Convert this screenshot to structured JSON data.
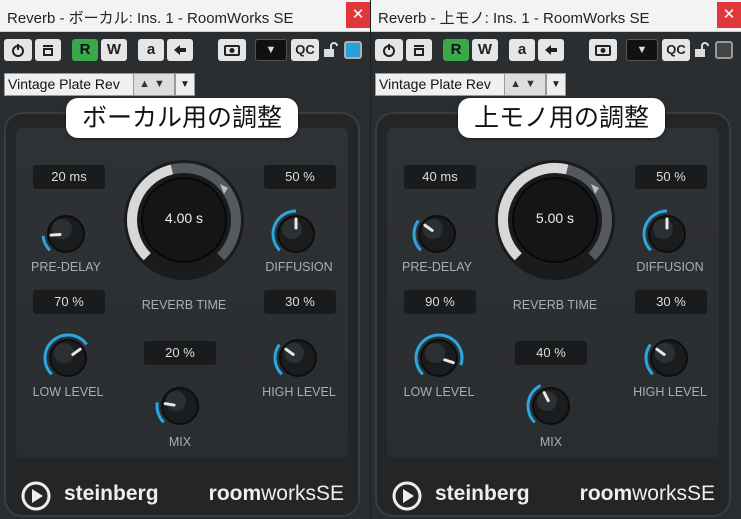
{
  "windows": [
    {
      "title": "Reverb - ボーカル: Ins. 1 - RoomWorks SE",
      "close_glyph": "✕",
      "toolbar": {
        "r_label": "R",
        "w_label": "W",
        "a_label": "a",
        "qc_label": "QC",
        "dropdown_glyph": "▼",
        "active_indicator": "blue"
      },
      "preset": {
        "name": "Vintage Plate Rev",
        "arrows": "▲▼",
        "dropdown": "▼"
      },
      "caption": "ボーカル用の調整",
      "params": {
        "pre_delay": {
          "label": "PRE-DELAY",
          "value": "20 ms",
          "level": 0.15
        },
        "diffusion": {
          "label": "DIFFUSION",
          "value": "50 %",
          "level": 0.5
        },
        "reverb_time": {
          "label": "REVERB TIME",
          "value": "4.00 s",
          "level": 0.45
        },
        "low_level": {
          "label": "LOW LEVEL",
          "value": "70 %",
          "level": 0.7
        },
        "high_level": {
          "label": "HIGH LEVEL",
          "value": "30 %",
          "level": 0.3
        },
        "mix": {
          "label": "MIX",
          "value": "20 %",
          "level": 0.2
        }
      },
      "footer": {
        "brand": "steinberg",
        "product_a": "room",
        "product_b": "works",
        "product_c": "SE"
      }
    },
    {
      "title": "Reverb - 上モノ: Ins. 1 - RoomWorks SE",
      "close_glyph": "✕",
      "toolbar": {
        "r_label": "R",
        "w_label": "W",
        "a_label": "a",
        "qc_label": "QC",
        "dropdown_glyph": "▼",
        "active_indicator": "grey"
      },
      "preset": {
        "name": "Vintage Plate Rev",
        "arrows": "▲▼",
        "dropdown": "▼"
      },
      "caption": "上モノ用の調整",
      "params": {
        "pre_delay": {
          "label": "PRE-DELAY",
          "value": "40 ms",
          "level": 0.3
        },
        "diffusion": {
          "label": "DIFFUSION",
          "value": "50 %",
          "level": 0.5
        },
        "reverb_time": {
          "label": "REVERB TIME",
          "value": "5.00 s",
          "level": 0.55
        },
        "low_level": {
          "label": "LOW LEVEL",
          "value": "90 %",
          "level": 0.9
        },
        "high_level": {
          "label": "HIGH LEVEL",
          "value": "30 %",
          "level": 0.3
        },
        "mix": {
          "label": "MIX",
          "value": "40 %",
          "level": 0.4
        }
      },
      "footer": {
        "brand": "steinberg",
        "product_a": "room",
        "product_b": "works",
        "product_c": "SE"
      }
    }
  ]
}
